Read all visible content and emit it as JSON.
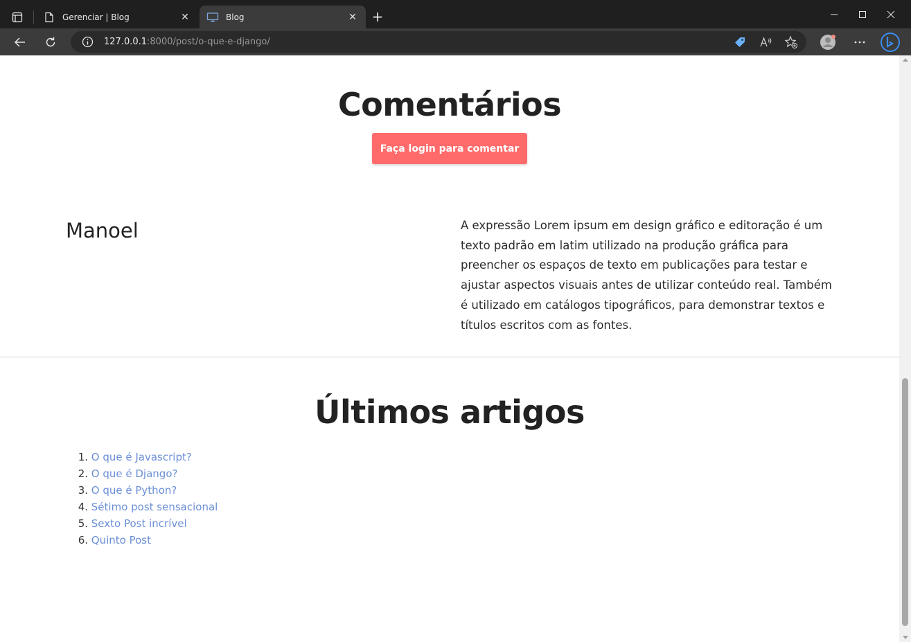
{
  "browser": {
    "tabs": [
      {
        "title": "Gerenciar | Blog",
        "icon": "page-icon",
        "active": false
      },
      {
        "title": "Blog",
        "icon": "monitor-icon",
        "active": true
      }
    ],
    "url": {
      "host": "127.0.0.1",
      "rest": ":8000/post/o-que-e-django/"
    }
  },
  "comments": {
    "title": "Comentários",
    "login_button": "Faça login para comentar",
    "items": [
      {
        "author": "Manoel",
        "body": "A expressão Lorem ipsum em design gráfico e editoração é um texto padrão em latim utilizado na produção gráfica para preencher os espaços de texto em publicações para testar e ajustar aspectos visuais antes de utilizar conteúdo real. Também é utilizado em catálogos tipográficos, para demonstrar textos e títulos escritos com as fontes."
      }
    ]
  },
  "latest": {
    "title": "Últimos artigos",
    "articles": [
      {
        "num": "1.",
        "title": "O que é Javascript?"
      },
      {
        "num": "2.",
        "title": "O que é Django?"
      },
      {
        "num": "3.",
        "title": "O que é Python?"
      },
      {
        "num": "4.",
        "title": "Sétimo post sensacional"
      },
      {
        "num": "5.",
        "title": "Sexto Post incrível"
      },
      {
        "num": "6.",
        "title": "Quinto Post"
      }
    ]
  },
  "colors": {
    "accent_button": "#ff6b6b",
    "link": "#6b8fd6"
  }
}
